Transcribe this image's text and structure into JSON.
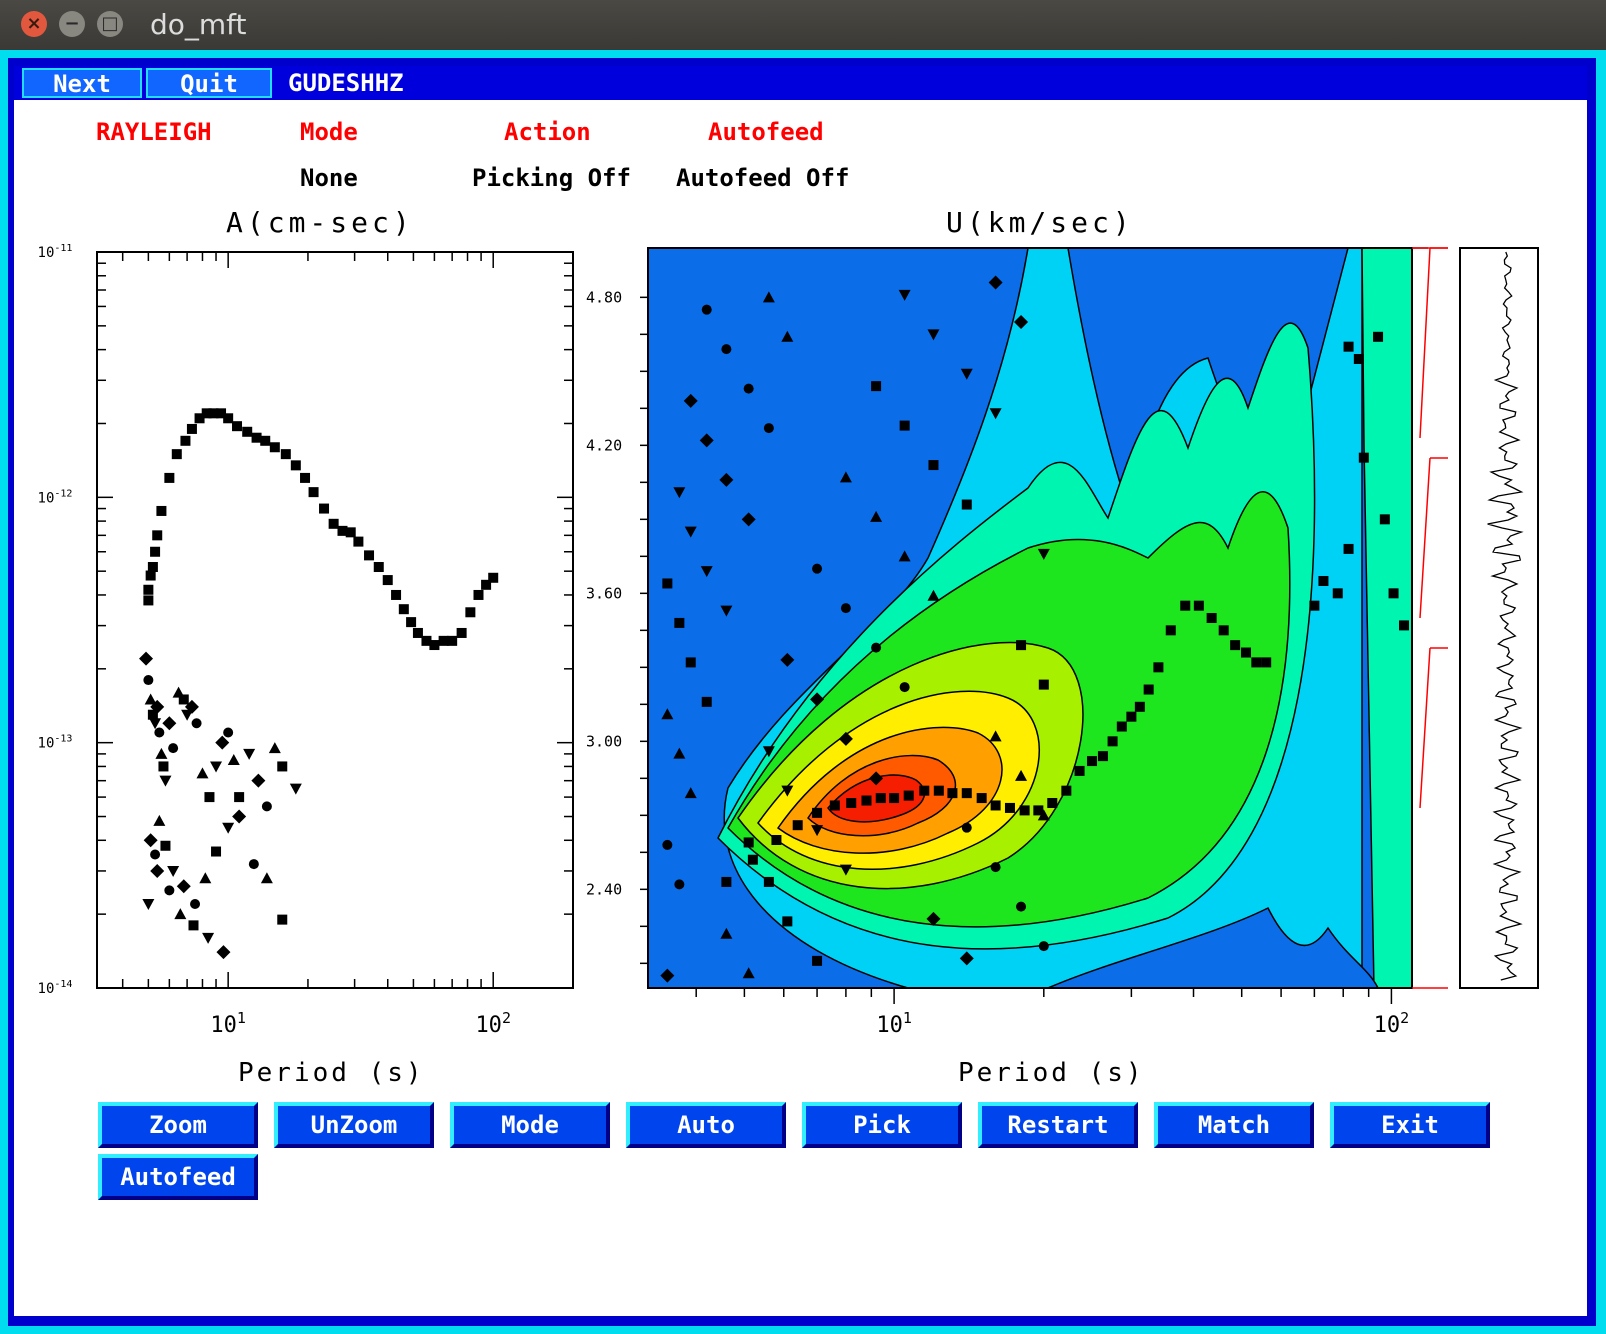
{
  "window": {
    "title": "do_mft"
  },
  "menu": {
    "next": "Next",
    "quit": "Quit",
    "station": "GUDESHHZ"
  },
  "header": {
    "wave": "RAYLEIGH",
    "mode_label": "Mode",
    "action_label": "Action",
    "autofeed_label": "Autofeed",
    "mode_value": "None",
    "action_value": "Picking Off",
    "autofeed_value": "Autofeed Off"
  },
  "left_plot": {
    "title": "A(cm-sec)",
    "xlabel": "Period (s)"
  },
  "right_plot": {
    "title": "U(km/sec)",
    "xlabel": "Period (s)"
  },
  "buttons": [
    "Zoom",
    "UnZoom",
    "Mode",
    "Auto",
    "Pick",
    "Restart",
    "Match",
    "Exit",
    "Autofeed"
  ],
  "colors": {
    "accent_red": "#ff0000",
    "button_blue": "#0044ee",
    "frame": "#0000cc"
  },
  "chart_data": [
    {
      "type": "scatter",
      "title": "A(cm-sec)",
      "xlabel": "Period (s)",
      "ylabel": "",
      "xscale": "log",
      "yscale": "log",
      "xlim": [
        3.2,
        200
      ],
      "ylim": [
        1e-14,
        1e-11
      ],
      "x_tick_labels": [
        "10^1",
        "10^2"
      ],
      "y_tick_labels": [
        "10^-11",
        "10^-12",
        "10^-13",
        "10^-14"
      ],
      "series": [
        {
          "marker": "square",
          "x": [
            5.0,
            5.0,
            5.1,
            5.2,
            5.3,
            5.4,
            5.6,
            6.0,
            6.4,
            6.9,
            7.3,
            7.8,
            8.3,
            8.8,
            9.4,
            10.0,
            10.8,
            11.8,
            12.8,
            13.8,
            15.0,
            16.5,
            18.0,
            19.5,
            21.0,
            23.0,
            25.0,
            27.0,
            29.0,
            31.0,
            34.0,
            37.0,
            40.0,
            43.0,
            46.0,
            49.0,
            52.0,
            56.0,
            60.0,
            65.0,
            70.0,
            76.0,
            82.0,
            88.0,
            94.0,
            100.0
          ],
          "y": [
            3.8e-13,
            4.2e-13,
            4.8e-13,
            5.2e-13,
            6e-13,
            7e-13,
            8.8e-13,
            1.2e-12,
            1.5e-12,
            1.7e-12,
            1.9e-12,
            2.1e-12,
            2.2e-12,
            2.2e-12,
            2.2e-12,
            2.1e-12,
            1.95e-12,
            1.85e-12,
            1.75e-12,
            1.7e-12,
            1.6e-12,
            1.5e-12,
            1.35e-12,
            1.2e-12,
            1.05e-12,
            9e-13,
            7.8e-13,
            7.3e-13,
            7.2e-13,
            6.6e-13,
            5.8e-13,
            5.2e-13,
            4.6e-13,
            4e-13,
            3.5e-13,
            3.1e-13,
            2.8e-13,
            2.6e-13,
            2.5e-13,
            2.6e-13,
            2.6e-13,
            2.8e-13,
            3.4e-13,
            4e-13,
            4.4e-13,
            4.7e-13
          ]
        },
        {
          "marker": "mixed",
          "x": [
            4.9,
            5.0,
            5.1,
            5.2,
            5.3,
            5.4,
            5.5,
            5.6,
            5.7,
            5.8,
            6.0,
            6.2,
            6.5,
            6.8,
            7.0,
            7.3,
            7.6,
            8.0,
            8.5,
            9.0,
            9.5,
            10.0,
            10.5,
            11.0,
            12.0,
            13.0,
            14.0,
            15.0,
            16.0,
            18.0,
            5.1,
            5.3,
            5.5,
            5.8,
            6.2,
            6.8,
            7.5,
            8.2,
            9.0,
            10.0,
            11.0,
            12.5,
            14.0,
            16.0,
            5.0,
            5.4,
            6.0,
            6.6,
            7.4,
            8.4,
            9.6
          ],
          "y": [
            2.2e-13,
            1.8e-13,
            1.5e-13,
            1.3e-13,
            1.2e-13,
            1.4e-13,
            1.1e-13,
            9e-14,
            8e-14,
            7e-14,
            1.2e-13,
            9.5e-14,
            1.6e-13,
            1.5e-13,
            1.3e-13,
            1.4e-13,
            1.2e-13,
            7.5e-14,
            6e-14,
            8e-14,
            1e-13,
            1.1e-13,
            8.5e-14,
            6e-14,
            9e-14,
            7e-14,
            5.5e-14,
            9.5e-14,
            8e-14,
            6.5e-14,
            4e-14,
            3.5e-14,
            4.8e-14,
            3.8e-14,
            3e-14,
            2.6e-14,
            2.2e-14,
            2.8e-14,
            3.6e-14,
            4.5e-14,
            5e-14,
            3.2e-14,
            2.8e-14,
            1.9e-14,
            2.2e-14,
            3e-14,
            2.5e-14,
            2e-14,
            1.8e-14,
            1.6e-14,
            1.4e-14
          ]
        }
      ]
    },
    {
      "type": "heatmap",
      "title": "U(km/sec)",
      "xlabel": "Period (s)",
      "xscale": "log",
      "xlim": [
        3.2,
        110
      ],
      "ylim": [
        2.0,
        5.0
      ],
      "x_tick_labels": [
        "10^1",
        "10^2"
      ],
      "y_tick_labels": [
        "4.80",
        "4.20",
        "3.60",
        "3.00",
        "2.40"
      ],
      "colorscale": [
        "#0b6ee8",
        "#00d2f5",
        "#00f5b0",
        "#1ee61e",
        "#a6f000",
        "#ffee00",
        "#ffa000",
        "#ff5a00",
        "#f51e00"
      ],
      "dispersion_points": {
        "x": [
          4.6,
          5.2,
          5.8,
          6.4,
          7.0,
          7.6,
          8.2,
          8.8,
          9.4,
          10.0,
          10.7,
          11.5,
          12.3,
          13.1,
          14.0,
          15.0,
          16.0,
          17.1,
          18.3,
          19.5,
          20.8,
          22.2,
          23.6,
          25.0,
          26.3,
          27.5,
          28.7,
          30.0,
          31.2,
          32.5,
          34.0,
          36.0,
          38.5,
          41.0,
          43.5,
          46.0,
          48.5,
          51.0,
          53.5,
          56.0
        ],
        "y": [
          2.43,
          2.52,
          2.6,
          2.66,
          2.71,
          2.74,
          2.75,
          2.76,
          2.77,
          2.77,
          2.78,
          2.8,
          2.8,
          2.79,
          2.79,
          2.77,
          2.74,
          2.73,
          2.72,
          2.72,
          2.75,
          2.8,
          2.88,
          2.92,
          2.94,
          3.0,
          3.06,
          3.1,
          3.14,
          3.21,
          3.3,
          3.45,
          3.55,
          3.55,
          3.5,
          3.45,
          3.39,
          3.36,
          3.32,
          3.32
        ]
      },
      "outlier_points": {
        "x": [
          70,
          73,
          78,
          82,
          88,
          94,
          97,
          101,
          106,
          82,
          86
        ],
        "y": [
          3.55,
          3.65,
          3.6,
          3.78,
          4.15,
          4.64,
          3.9,
          3.6,
          3.47,
          4.6,
          4.55
        ],
        "marker": "square"
      }
    }
  ]
}
